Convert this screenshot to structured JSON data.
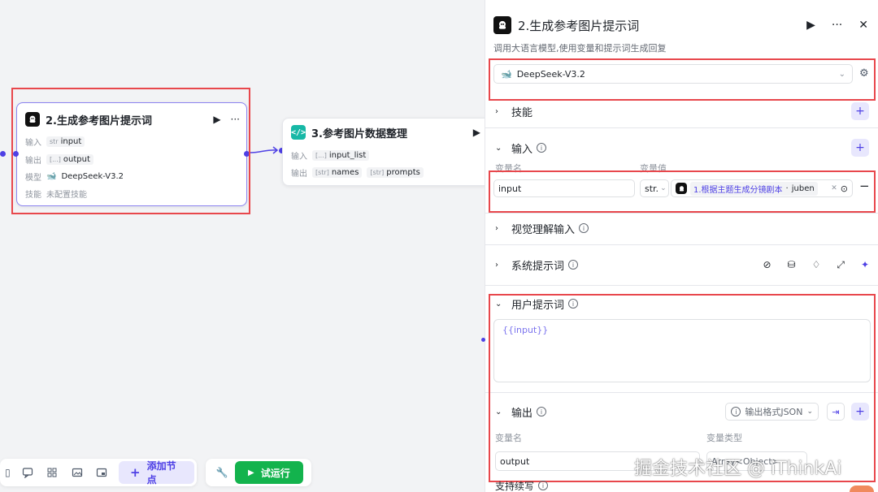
{
  "canvas": {
    "node_prompt": {
      "title": "2.生成参考图片提示词",
      "rows": [
        {
          "label": "输入",
          "type_tag": "str",
          "value": "input"
        },
        {
          "label": "输出",
          "type_tag": "[...]",
          "value": "output"
        },
        {
          "label": "模型",
          "value": "DeepSeek-V3.2"
        },
        {
          "label": "技能",
          "value": "未配置技能"
        }
      ]
    },
    "node_code": {
      "icon_text": "</>",
      "title": "3.参考图片数据整理",
      "rows": [
        {
          "label": "输入",
          "type_tag": "[...]",
          "value": "input_list"
        },
        {
          "label": "输出",
          "type_tag": "[str]",
          "value": "names",
          "type_tag2": "[str]",
          "value2": "prompts"
        }
      ]
    },
    "toolbar": {
      "add_node": "添加节点",
      "run": "试运行"
    }
  },
  "panel": {
    "title": "2.生成参考图片提示词",
    "description": "调用大语言模型,使用变量和提示词生成回复",
    "model": "DeepSeek-V3.2",
    "sections": {
      "skills": "技能",
      "input": "输入",
      "vision": "视觉理解输入",
      "system_prompt": "系统提示词",
      "user_prompt": "用户提示词",
      "output": "输出",
      "continue": "支持续写"
    },
    "input_columns": {
      "name": "变量名",
      "value": "变量值"
    },
    "input_row": {
      "name": "input",
      "type": "str.",
      "ref_node": "1.根据主题生成分镜剧本",
      "ref_var": "juben"
    },
    "user_prompt_text": "{{input}}",
    "output_format": "输出格式JSON",
    "output_columns": {
      "name": "变量名",
      "type": "变量类型"
    },
    "output_row": {
      "name": "output",
      "type": "Array<Object>"
    }
  },
  "watermark": "掘金技术社区 @ iThinkAi",
  "colors": {
    "accent": "#4e40e5",
    "highlight": "#e8474c",
    "run": "#13b34d"
  }
}
